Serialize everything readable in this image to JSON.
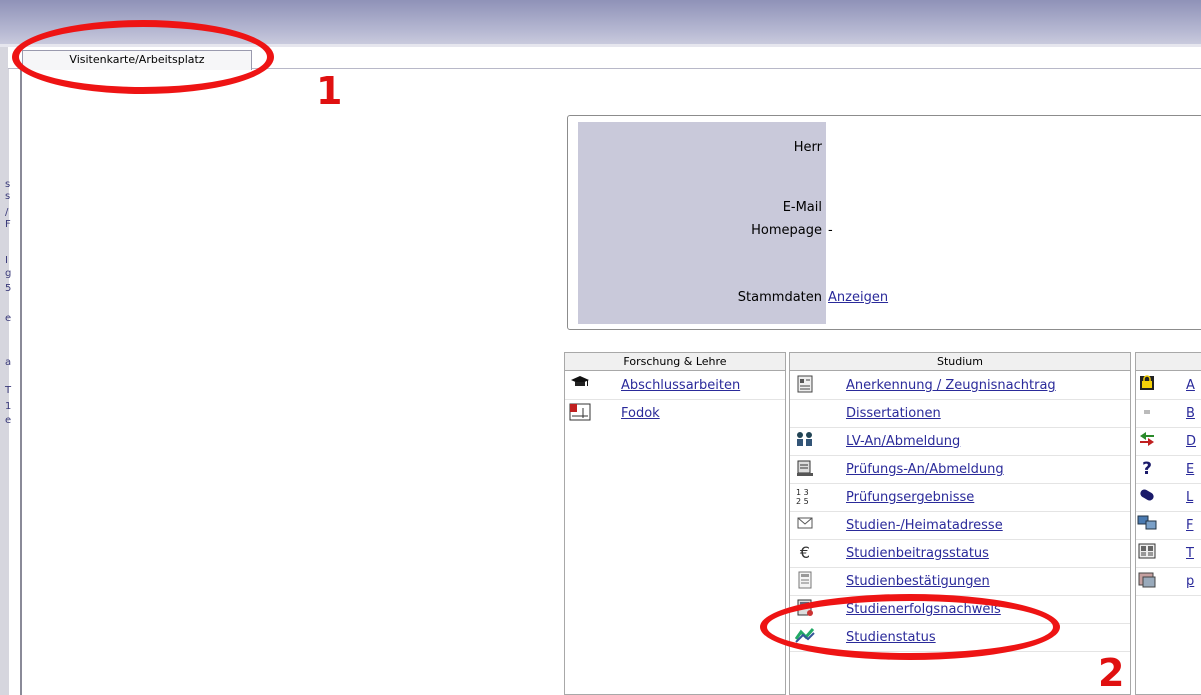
{
  "tab": {
    "label": "Visitenkarte/Arbeitsplatz"
  },
  "left_clip": [
    "s",
    "s",
    "/",
    "F",
    "I",
    "g",
    "5",
    "e",
    "a",
    "T",
    "1",
    "e"
  ],
  "card": {
    "salutation_label": "Herr",
    "email_label": "E-Mail",
    "homepage_label": "Homepage",
    "homepage_value": "-",
    "stammdaten_label": "Stammdaten",
    "stammdaten_link": "Anzeigen"
  },
  "panels": {
    "forschung": {
      "title": "Forschung & Lehre",
      "items": [
        {
          "label": "Abschlussarbeiten",
          "icon": "graduation-cap-icon"
        },
        {
          "label": "Fodok",
          "icon": "chart-icon"
        }
      ]
    },
    "studium": {
      "title": "Studium",
      "items": [
        {
          "label": "Anerkennung / Zeugnisnachtrag",
          "icon": "document-icon"
        },
        {
          "label": "Dissertationen",
          "icon": ""
        },
        {
          "label": "LV-An/Abmeldung",
          "icon": "people-icon"
        },
        {
          "label": "Prüfungs-An/Abmeldung",
          "icon": "exam-icon"
        },
        {
          "label": "Prüfungsergebnisse",
          "icon": "grades-icon"
        },
        {
          "label": "Studien-/Heimatadresse",
          "icon": "envelope-icon"
        },
        {
          "label": "Studienbeitragsstatus",
          "icon": "euro-icon"
        },
        {
          "label": "Studienbestätigungen",
          "icon": "certificate-icon"
        },
        {
          "label": "Studienerfolgsnachweis",
          "icon": "report-icon"
        },
        {
          "label": "Studienstatus",
          "icon": "status-icon"
        }
      ]
    },
    "right": {
      "items": [
        {
          "label": "A",
          "icon": "lock-icon"
        },
        {
          "label": "B",
          "icon": "dot-icon"
        },
        {
          "label": "D",
          "icon": "arrows-icon"
        },
        {
          "label": "E",
          "icon": "help-icon"
        },
        {
          "label": "L",
          "icon": "pill-icon"
        },
        {
          "label": "F",
          "icon": "computer-icon"
        },
        {
          "label": "T",
          "icon": "grid-icon"
        },
        {
          "label": "p",
          "icon": "photo-icon"
        }
      ]
    }
  },
  "annotations": {
    "marker_1": "1",
    "marker_2": "2",
    "color": "#ee1414"
  }
}
